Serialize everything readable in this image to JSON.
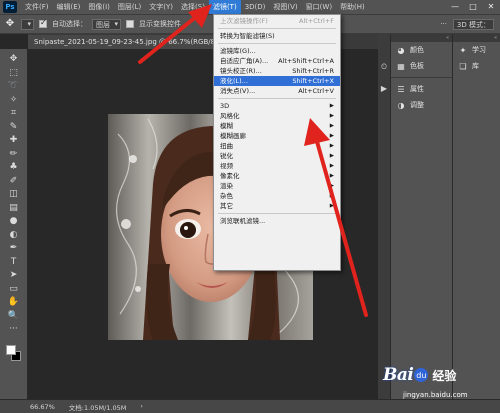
{
  "menubar": {
    "logo": "Ps",
    "items": [
      "文件(F)",
      "编辑(E)",
      "图像(I)",
      "图层(L)",
      "文字(Y)",
      "选择(S)",
      "滤镜(T)",
      "3D(D)",
      "视图(V)",
      "窗口(W)",
      "帮助(H)"
    ],
    "active_index": 6,
    "window_controls": [
      "—",
      "□",
      "✕"
    ]
  },
  "options_bar": {
    "auto_select_label": "自动选择：",
    "auto_select_value": "图层",
    "show_transform_label": "显示变换控件",
    "mode_3d": "3D 模式：",
    "more_icon": "···"
  },
  "document": {
    "tab_title": "Snipaste_2021-05-19_09-23-45.jpg @ 66.7%(RGB/8#)"
  },
  "toolbar": {
    "tools": [
      "move-icon",
      "marquee-icon",
      "lasso-icon",
      "quick-select-icon",
      "crop-icon",
      "eyedropper-icon",
      "healing-icon",
      "brush-icon",
      "stamp-icon",
      "history-brush-icon",
      "eraser-icon",
      "gradient-icon",
      "blur-icon",
      "dodge-icon",
      "pen-icon",
      "type-icon",
      "path-select-icon",
      "rectangle-icon",
      "hand-icon",
      "zoom-icon",
      "more-icon"
    ],
    "glyphs": [
      "✥",
      "⬚",
      "➰",
      "✧",
      "⌗",
      "✎",
      "✚",
      "✏",
      "♣",
      "✐",
      "◫",
      "▤",
      "●",
      "◐",
      "✒",
      "T",
      "➤",
      "▭",
      "✋",
      "🔍",
      "···"
    ],
    "foreground_color": "#ffffff",
    "background_color": "#000000"
  },
  "filter_menu": {
    "items": [
      {
        "label": "上次滤镜操作(F)",
        "shortcut": "Alt+Ctrl+F",
        "disabled": true
      },
      {
        "separator": true
      },
      {
        "label": "转换为智能滤镜(S)",
        "shortcut": ""
      },
      {
        "separator": true
      },
      {
        "label": "滤镜库(G)...",
        "shortcut": ""
      },
      {
        "label": "自适应广角(A)...",
        "shortcut": "Alt+Shift+Ctrl+A"
      },
      {
        "label": "镜头校正(R)...",
        "shortcut": "Shift+Ctrl+R"
      },
      {
        "label": "液化(L)...",
        "shortcut": "Shift+Ctrl+X",
        "highlighted": true
      },
      {
        "label": "消失点(V)...",
        "shortcut": "Alt+Ctrl+V"
      },
      {
        "separator": true
      },
      {
        "label": "3D",
        "submenu": true
      },
      {
        "label": "风格化",
        "submenu": true
      },
      {
        "label": "模糊",
        "submenu": true
      },
      {
        "label": "模糊画廊",
        "submenu": true
      },
      {
        "label": "扭曲",
        "submenu": true
      },
      {
        "label": "锐化",
        "submenu": true
      },
      {
        "label": "视频",
        "submenu": true
      },
      {
        "label": "像素化",
        "submenu": true
      },
      {
        "label": "渲染",
        "submenu": true
      },
      {
        "label": "杂色",
        "submenu": true
      },
      {
        "label": "其它",
        "submenu": true
      },
      {
        "separator": true
      },
      {
        "label": "浏览联机滤镜...",
        "shortcut": ""
      }
    ]
  },
  "panels": {
    "col1": [
      {
        "icon": "color-wheel-icon",
        "glyph": "◕",
        "label": "颜色"
      },
      {
        "icon": "swatches-icon",
        "glyph": "▦",
        "label": "色板"
      },
      {
        "sep": true
      },
      {
        "icon": "properties-icon",
        "glyph": "☰",
        "label": "属性"
      },
      {
        "icon": "adjustments-icon",
        "glyph": "◑",
        "label": "调整"
      }
    ],
    "col2": [
      {
        "icon": "learn-icon",
        "glyph": "✦",
        "label": "学习"
      },
      {
        "icon": "library-icon",
        "glyph": "❏",
        "label": "库"
      }
    ]
  },
  "status": {
    "zoom": "66.67%",
    "doc_info": "文档:1.05M/1.05M",
    "arrow": "›"
  },
  "watermark": {
    "bai": "Bai",
    "paw": "du",
    "cn": "经验",
    "url": "jingyan.baidu.com"
  },
  "annotation_color": "#e0231c"
}
